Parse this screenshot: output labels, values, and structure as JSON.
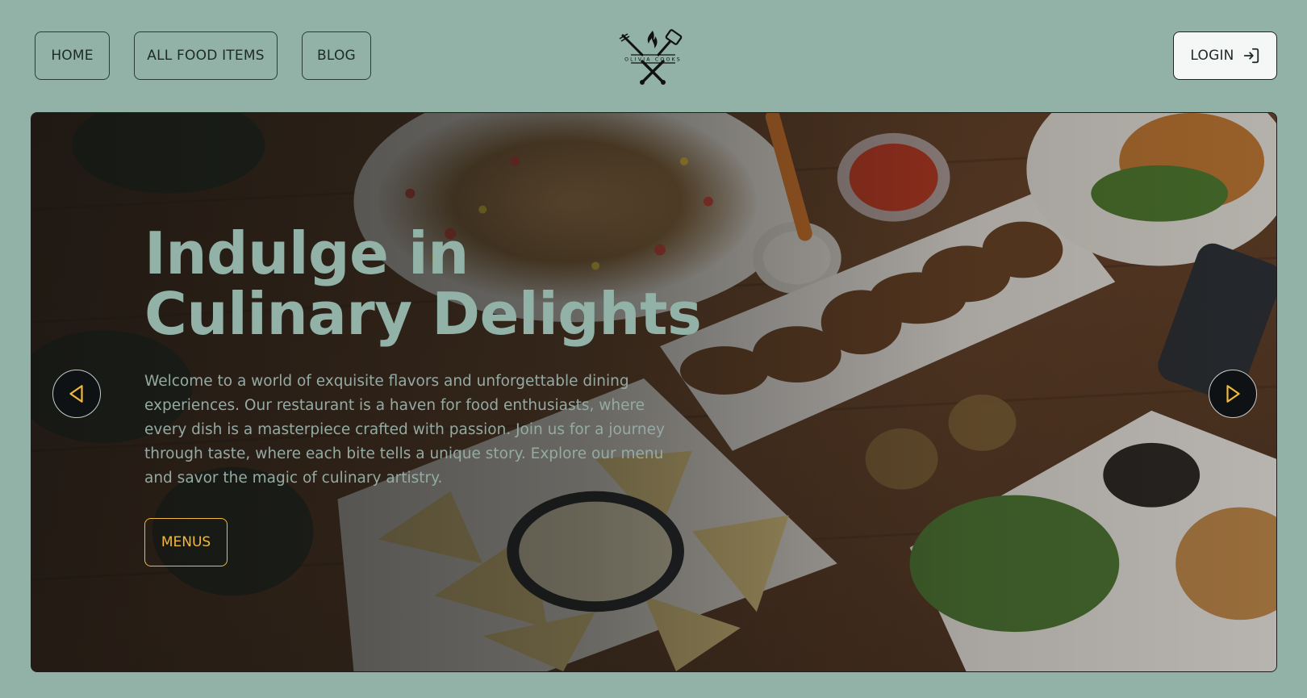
{
  "nav": {
    "home_label": "HOME",
    "all_food_label": "ALL FOOD ITEMS",
    "blog_label": "BLOG",
    "login_label": "LOGIN"
  },
  "logo": {
    "text": "OLIVIA COOKS",
    "icon": "crossed-fork-spatula-flame-logo"
  },
  "hero": {
    "title_line1": "Indulge in",
    "title_line2": "Culinary Delights",
    "description": "Welcome to a world of exquisite flavors and unforgettable dining experiences. Our restaurant is a haven for food enthusiasts, where every dish is a masterpiece crafted with passion. Join us for a journey through taste, where each bite tells a unique story. Explore our menu and savor the magic of culinary artistry.",
    "cta_label": "MENUS",
    "prev_icon": "triangle-left-icon",
    "next_icon": "triangle-right-icon"
  },
  "colors": {
    "page_bg": "#92b2a7",
    "title": "#92b2a7",
    "accent": "#f2b93a",
    "dark": "#0e1214"
  }
}
